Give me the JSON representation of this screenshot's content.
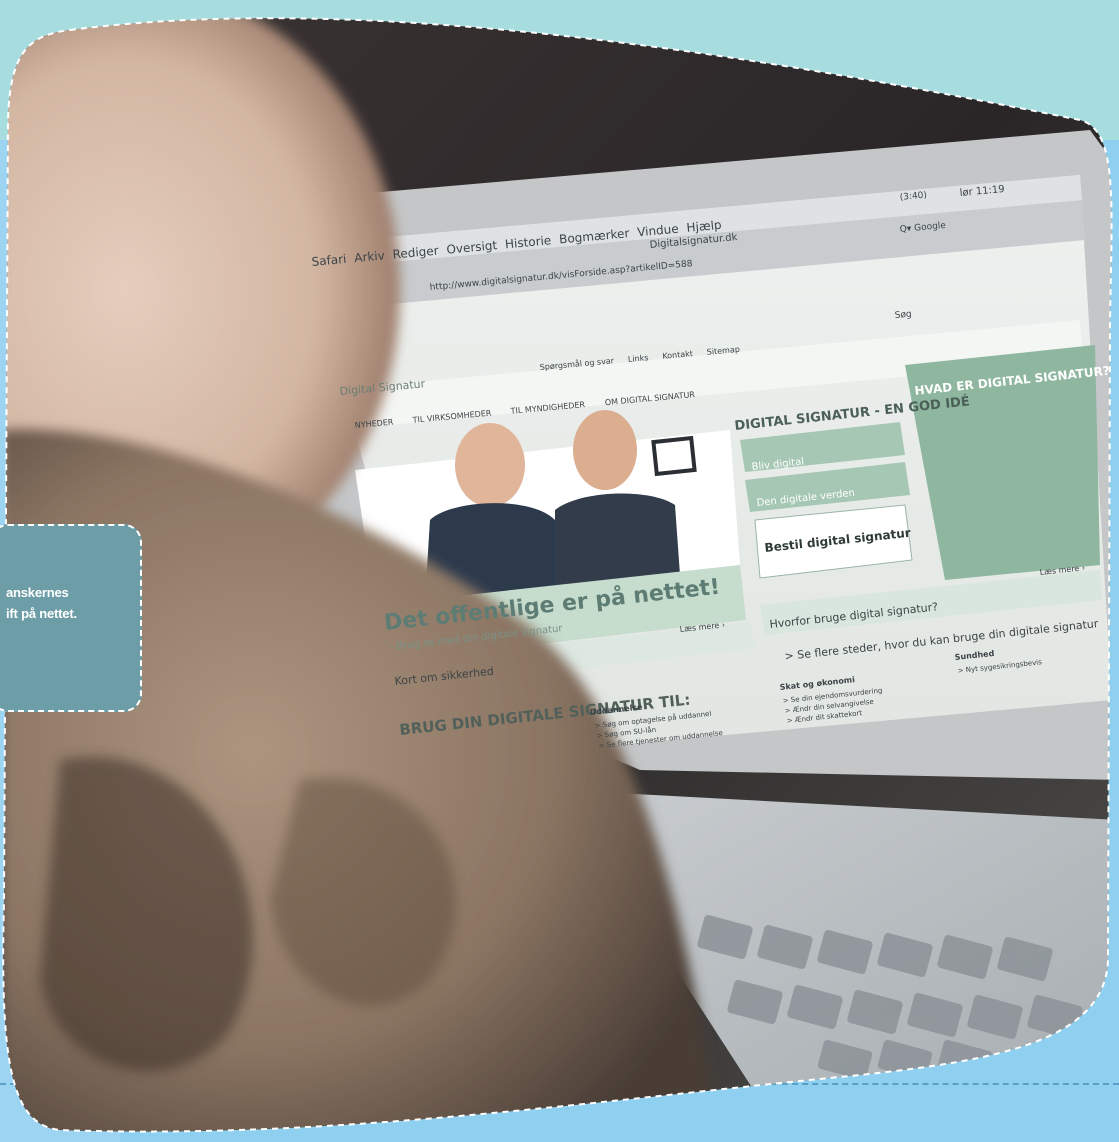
{
  "callout": {
    "line1": "anskernes",
    "line2": "ift på nettet."
  },
  "screen": {
    "menubar": [
      "Safari",
      "Arkiv",
      "Rediger",
      "Oversigt",
      "Historie",
      "Bogmærker",
      "Vindue",
      "Hjælp"
    ],
    "window_title": "Digitalsignatur.dk",
    "url": "http://www.digitalsignatur.dk/visForside.asp?artikelID=588",
    "clock": "lør 11:19",
    "battery": "(3:40)",
    "search_label": "Søg",
    "search_engine": "Q▾ Google",
    "logo": "Digital Signatur",
    "top_links": [
      "Spørgsmål og svar",
      "Links",
      "Kontakt",
      "Sitemap"
    ],
    "tabs": [
      "NYHEDER",
      "TIL VIRKSOMHEDER",
      "TIL MYNDIGHEDER",
      "OM DIGITAL SIGNATUR"
    ],
    "hero_title": "Det offentlige er på nettet!",
    "hero_sub": "- Brug os med din digitale signatur",
    "las_mere": "Læs mere ›",
    "sikkerhed": "Kort om sikkerhed",
    "brug_heading": "BRUG DIN DIGITALE SIGNATUR TIL:",
    "idea_title": "DIGITAL SIGNATUR - EN GOD IDÉ",
    "btn1": "Bliv digital",
    "btn2": "Den digitale verden",
    "bestil": "Bestil digital signatur",
    "hvad_title": "HVAD ER DIGITAL SIGNATUR?",
    "hvorfor": "Hvorfor bruge digital signatur?",
    "se_flere": "> Se flere steder, hvor du kan bruge din digitale signatur",
    "uddannelse": "Uddannelse",
    "skat": "Skat og økonomi",
    "sundhed": "Sundhed",
    "ud_links": [
      "> Søg om optagelse på uddannel",
      "> Søg om SU-lån",
      "> Se flere tjenester om uddannelse"
    ],
    "skat_links": [
      "> Se din ejendomsvurdering",
      "> Ændr din selvangivelse",
      "> Ændr dit skattekort"
    ],
    "sund_links": [
      "> Nyt sygesikringsbevis"
    ]
  },
  "colors": {
    "top_band": "#a8dde0",
    "side_band": "#9cd4f2",
    "callout_bg": "#6d9ea8",
    "site_green": "#8fb7a0"
  }
}
